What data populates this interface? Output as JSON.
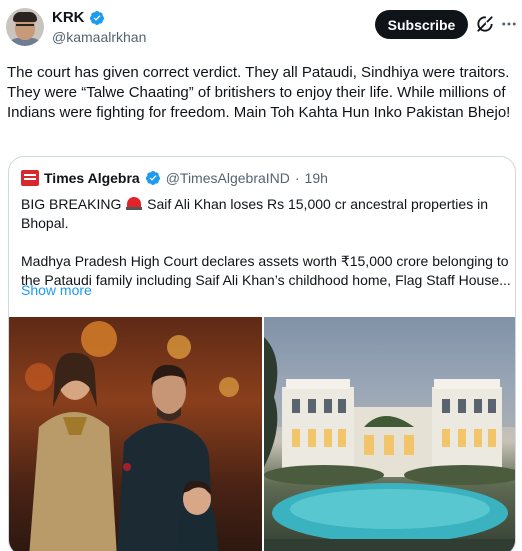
{
  "author": {
    "name": "KRK",
    "handle": "@kamaalrkhan",
    "verified": true
  },
  "actions": {
    "subscribe_label": "Subscribe",
    "grok_icon": "grok-icon",
    "more_icon": "more-options-icon"
  },
  "tweet": {
    "text": "The court has given correct verdict. They all Pataudi, Sindhiya were traitors. They were “Talwe Chaating” of britishers to enjoy their life. While millions of Indians were fighting for freedom. Main Toh Kahta Hun Inko Pakistan Bhejo!"
  },
  "quote": {
    "name": "Times Algebra",
    "handle": "@TimesAlgebraIND",
    "separator": "·",
    "time": "19h",
    "line1_before": "BIG BREAKING",
    "line1_after": "Saif Ali Khan loses Rs 15,000 cr ancestral properties in Bhopal.",
    "line2": "Madhya Pradesh High Court declares assets worth ₹15,000 crore belonging to the Pataudi family including Saif Ali Khan’s childhood home, Flag Staff House...",
    "show_more": "Show more"
  },
  "colors": {
    "verified_blue": "#1d9bf0",
    "link_blue": "#1d9bf0",
    "text": "#0f1419",
    "secondary": "#536471",
    "border": "#cfd9de",
    "button_bg": "#0f1419"
  }
}
